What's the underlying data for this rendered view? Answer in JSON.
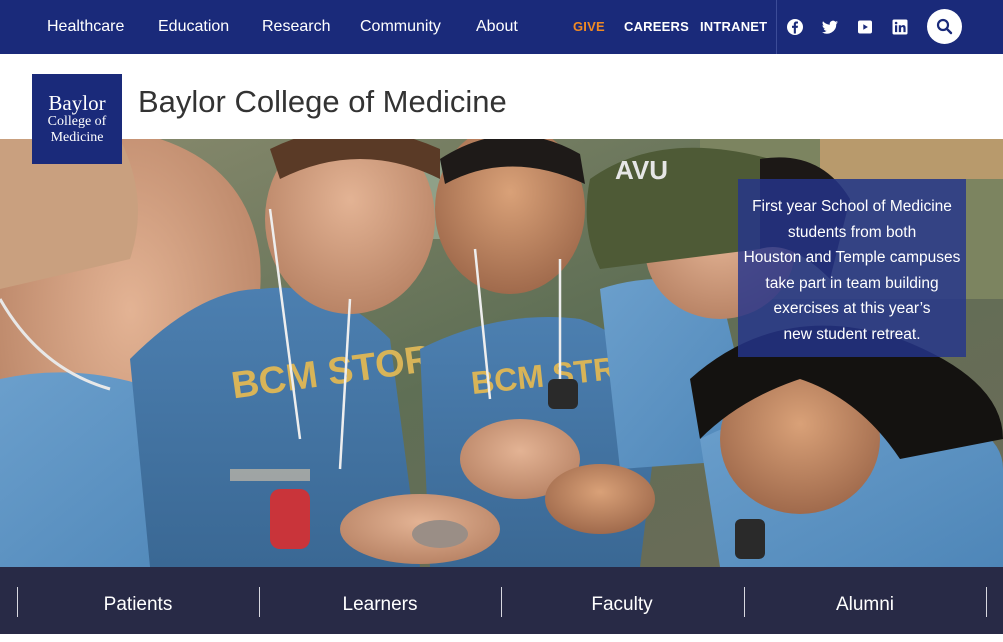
{
  "topnav": {
    "main_links": [
      "Healthcare",
      "Education",
      "Research",
      "Community",
      "About"
    ],
    "utility_links": [
      "GIVE",
      "CAREERS",
      "INTRANET"
    ],
    "social_icons": [
      "facebook-icon",
      "twitter-icon",
      "youtube-icon",
      "linkedin-icon"
    ],
    "search_icon": "search-icon",
    "colors": {
      "background": "#1a2a7a",
      "give_accent": "#f08a24"
    }
  },
  "header": {
    "logo": {
      "line1": "Baylor",
      "line2": "College of",
      "line3": "Medicine"
    },
    "title": "Baylor College of Medicine"
  },
  "hero": {
    "caption_lines": [
      "First year School of Medicine",
      "students from both",
      "Houston and Temple campuses",
      "take part in team building",
      "exercises at this year’s",
      "new student retreat."
    ]
  },
  "audience_nav": {
    "items": [
      "Patients",
      "Learners",
      "Faculty",
      "Alumni"
    ],
    "colors": {
      "background": "#282a46"
    }
  }
}
